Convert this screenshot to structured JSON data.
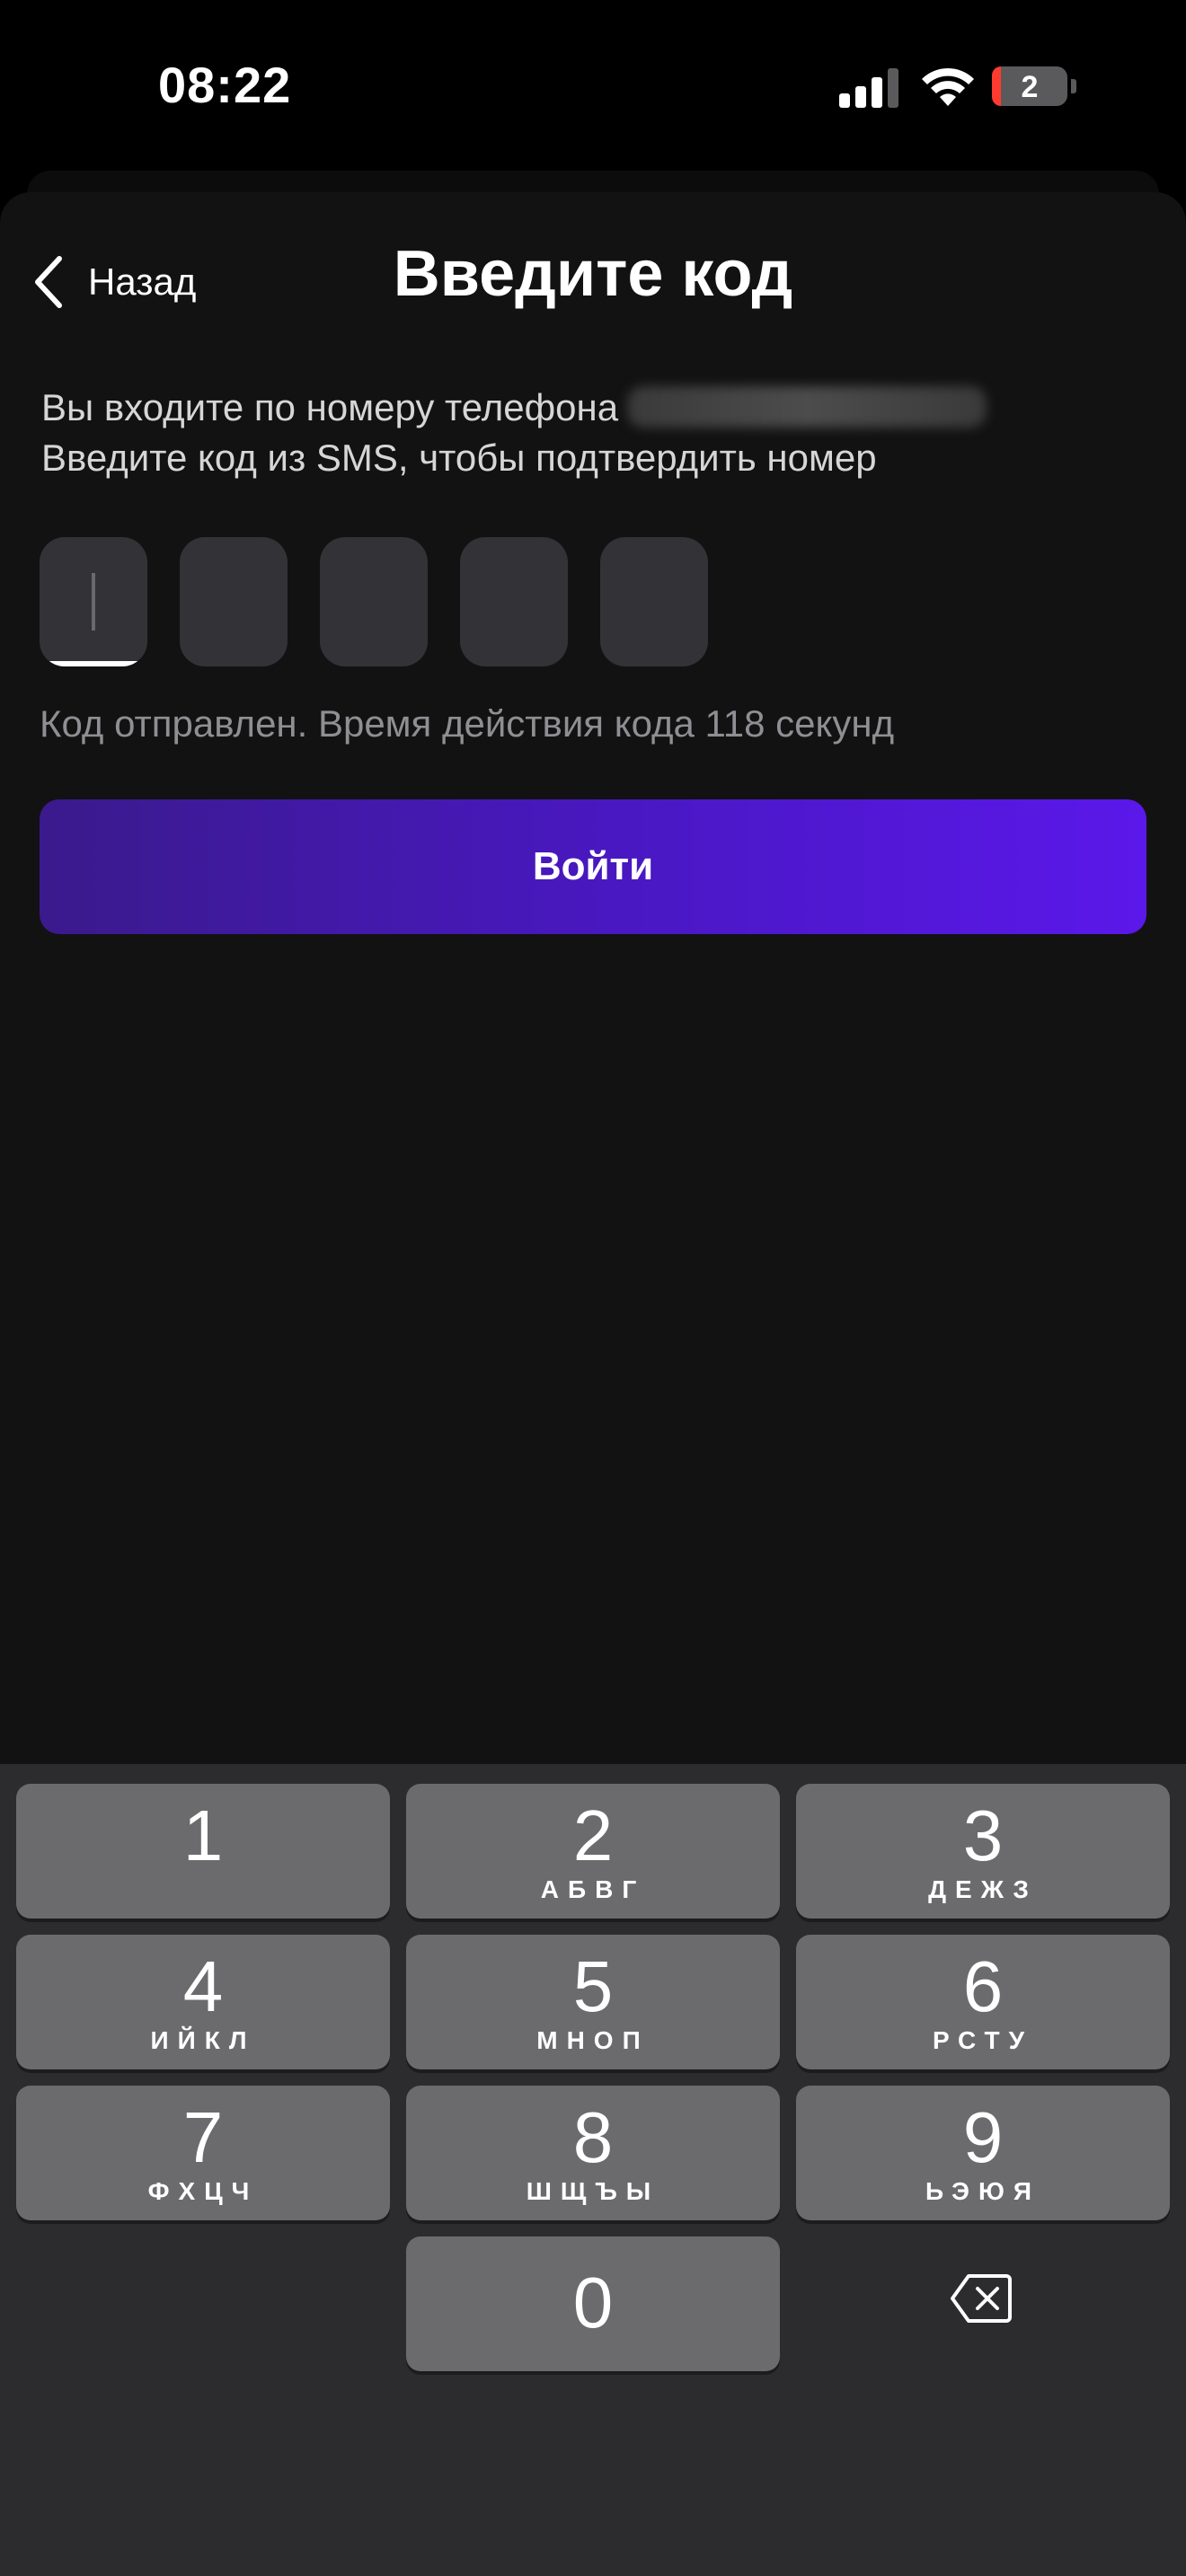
{
  "status": {
    "time": "08:22",
    "battery": "2"
  },
  "header": {
    "back_label": "Назад",
    "title": "Введите код"
  },
  "description": {
    "line1": "Вы входите по номеру телефона",
    "line2": "Введите код из SMS, чтобы подтвердить номер"
  },
  "code_inputs": {
    "count": 5,
    "active_index": 0
  },
  "hint": "Код отправлен. Время действия кода 118 секунд",
  "login_button": "Войти",
  "keypad": {
    "keys": [
      {
        "digit": "1",
        "letters": ""
      },
      {
        "digit": "2",
        "letters": "АБВГ"
      },
      {
        "digit": "3",
        "letters": "ДЕЖЗ"
      },
      {
        "digit": "4",
        "letters": "ИЙКЛ"
      },
      {
        "digit": "5",
        "letters": "МНОП"
      },
      {
        "digit": "6",
        "letters": "РСТУ"
      },
      {
        "digit": "7",
        "letters": "ФХЦЧ"
      },
      {
        "digit": "8",
        "letters": "ШЩЪЫ"
      },
      {
        "digit": "9",
        "letters": "ЬЭЮЯ"
      },
      {
        "digit": "0",
        "letters": ""
      }
    ],
    "backspace_icon": "delete-left-icon"
  },
  "colors": {
    "accent_start": "#3a1a8c",
    "accent_end": "#5b18ea",
    "background": "#121212",
    "input_bg": "#333337"
  }
}
